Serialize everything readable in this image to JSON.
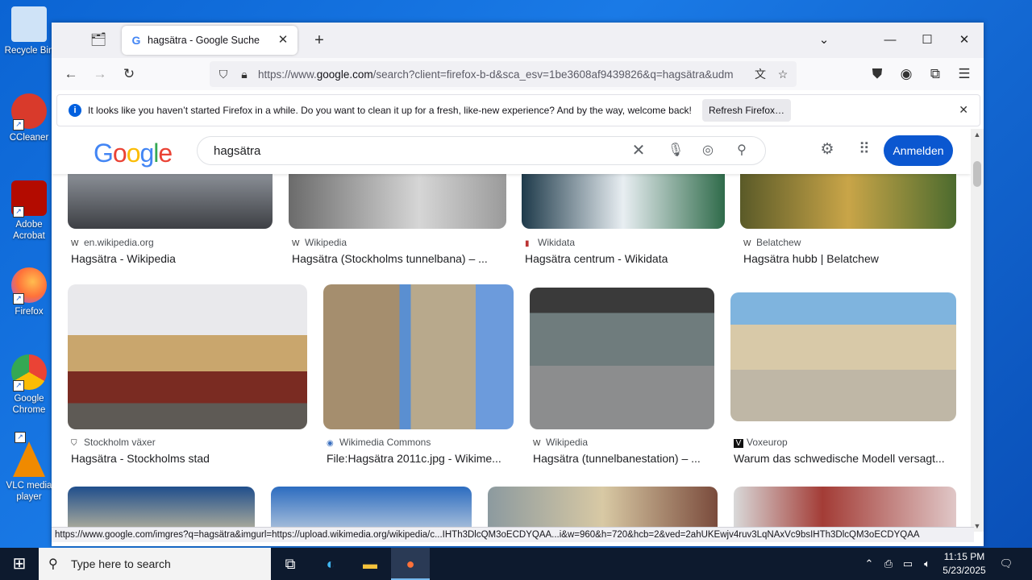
{
  "desktop": {
    "icons": [
      {
        "label": "Recycle Bin",
        "name": "recycle-bin-icon",
        "color": "#9fc3e8"
      },
      {
        "label": "CCleaner",
        "name": "ccleaner-icon",
        "color": "#d93a2b"
      },
      {
        "label": "Adobe Acrobat",
        "name": "adobe-acrobat-icon",
        "color": "#b30b00"
      },
      {
        "label": "Firefox",
        "name": "firefox-icon",
        "color": "#ff7139"
      },
      {
        "label": "Google Chrome",
        "name": "google-chrome-icon",
        "color": "#1a73e8"
      },
      {
        "label": "VLC media player",
        "name": "vlc-icon",
        "color": "#f08a00"
      }
    ]
  },
  "browser": {
    "tab_title": "hagsätra - Google Suche",
    "url_prefix": "https://www.",
    "url_domain": "google.com",
    "url_rest": "/search?client=firefox-b-d&sca_esv=1be3608af9439826&q=hagsätra&udm",
    "notification": {
      "message": "It looks like you haven’t started Firefox in a while. Do you want to clean it up for a fresh, like-new experience? And by the way, welcome back!",
      "button": "Refresh Firefox…"
    },
    "status_url": "https://www.google.com/imgres?q=hagsätra&imgurl=https://upload.wikimedia.org/wikipedia/c...IHTh3DlcQM3oECDYQAA...i&w=960&h=720&hcb=2&ved=2ahUKEwjv4ruv3LqNAxVc9bsIHTh3DlcQM3oECDYQAA"
  },
  "google": {
    "logo": [
      "G",
      "o",
      "o",
      "g",
      "l",
      "e"
    ],
    "query": "hagsätra",
    "signin": "Anmelden",
    "results_row1": [
      {
        "source": "en.wikipedia.org",
        "title": "Hagsätra - Wikipedia"
      },
      {
        "source": "Wikipedia",
        "title": "Hagsätra (Stockholms tunnelbana) – ..."
      },
      {
        "source": "Wikidata",
        "title": "Hagsätra centrum - Wikidata"
      },
      {
        "source": "Belatchew",
        "title": "Hagsätra hubb | Belatchew"
      }
    ],
    "results_row2": [
      {
        "source": "Stockholm växer",
        "title": "Hagsätra - Stockholms stad"
      },
      {
        "source": "Wikimedia Commons",
        "title": "File:Hagsätra 2011c.jpg - Wikime..."
      },
      {
        "source": "Wikipedia",
        "title": "Hagsätra (tunnelbanestation) – ..."
      },
      {
        "source": "Voxeurop",
        "title": "Warum das schwedische Modell versagt..."
      }
    ]
  },
  "taskbar": {
    "search_placeholder": "Type here to search",
    "time": "11:15 PM",
    "date": "5/23/2025"
  }
}
